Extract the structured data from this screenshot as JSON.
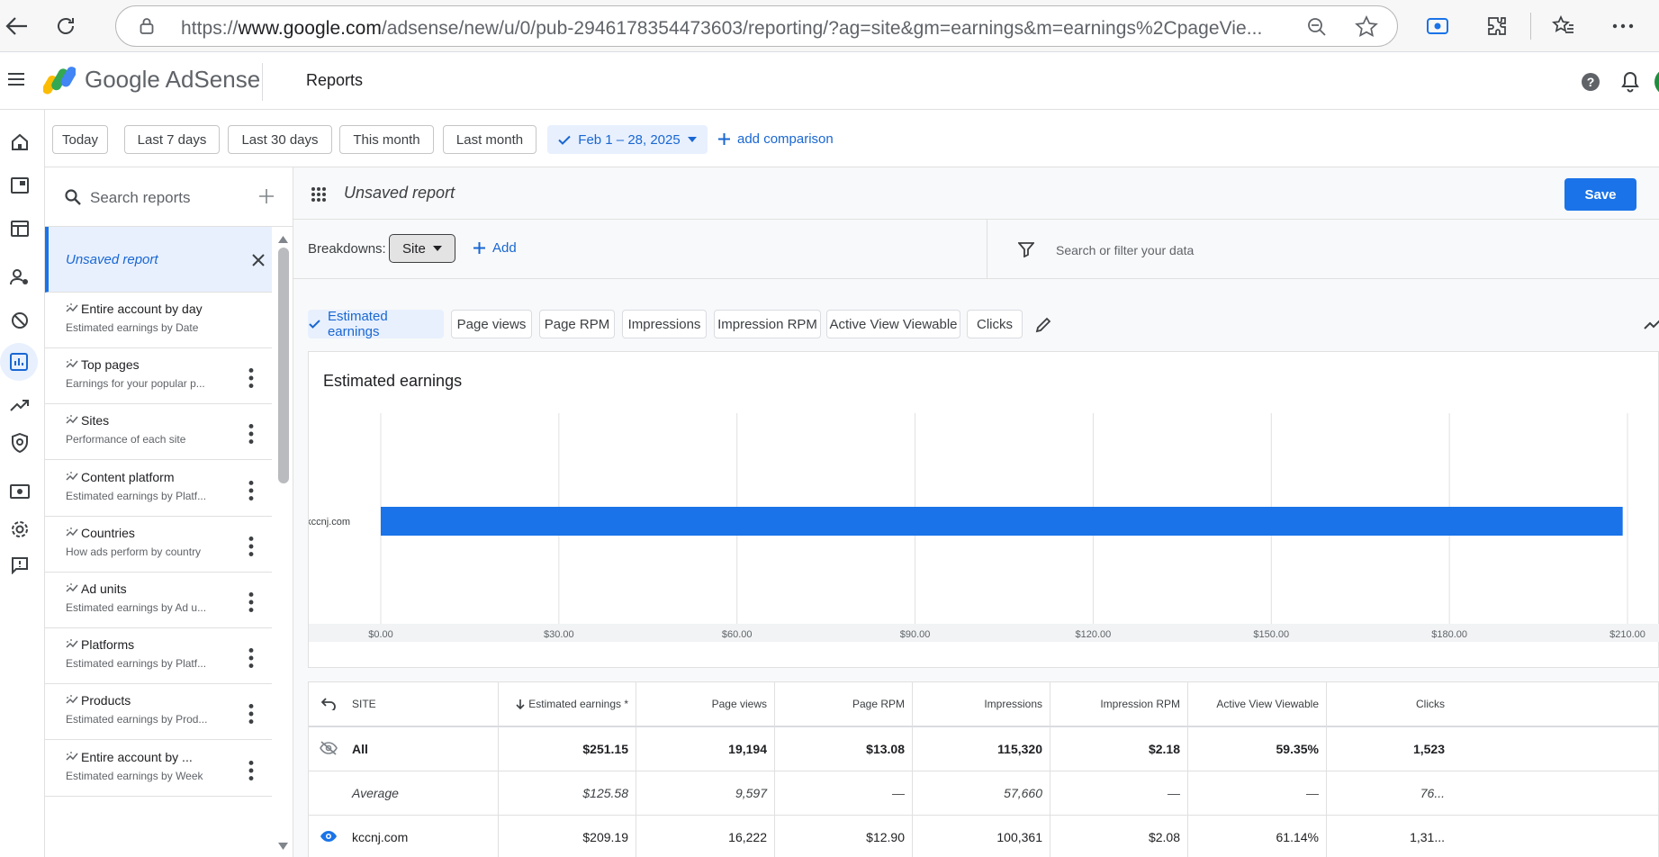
{
  "browser": {
    "url_scheme": "https://",
    "url_host": "www.google.com",
    "url_path": "/adsense/new/u/0/pub-2946178354473603/reporting/?ag=site&gm=earnings&m=earnings%2CpageVie..."
  },
  "header": {
    "brand": "Google AdSense",
    "title": "Reports"
  },
  "date_chips": [
    "Today",
    "Last 7 days",
    "Last 30 days",
    "This month",
    "Last month"
  ],
  "date_range": "Feb 1 – 28, 2025",
  "add_comparison": "add comparison",
  "report_list": {
    "search_placeholder": "Search reports",
    "active_item": "Unsaved report",
    "items": [
      {
        "title": "Entire account by day",
        "subtitle": "Estimated earnings by Date"
      },
      {
        "title": "Top pages",
        "subtitle": "Earnings for your popular p..."
      },
      {
        "title": "Sites",
        "subtitle": "Performance of each site"
      },
      {
        "title": "Content platform",
        "subtitle": "Estimated earnings by Platf..."
      },
      {
        "title": "Countries",
        "subtitle": "How ads perform by country"
      },
      {
        "title": "Ad units",
        "subtitle": "Estimated earnings by Ad u..."
      },
      {
        "title": "Platforms",
        "subtitle": "Estimated earnings by Platf..."
      },
      {
        "title": "Products",
        "subtitle": "Estimated earnings by Prod..."
      },
      {
        "title": "Entire account by ...",
        "subtitle": "Estimated earnings by Week"
      }
    ]
  },
  "report": {
    "name": "Unsaved report",
    "save_label": "Save",
    "breakdowns_label": "Breakdowns:",
    "breakdown_value": "Site",
    "add_label": "Add",
    "filter_placeholder": "Search or filter your data",
    "metrics": [
      "Estimated earnings",
      "Page views",
      "Page RPM",
      "Impressions",
      "Impression RPM",
      "Active View Viewable",
      "Clicks"
    ],
    "active_metric": "Estimated earnings"
  },
  "colors": {
    "accent": "#1a73e8",
    "bar": "#1a73e8"
  },
  "chart_data": {
    "type": "bar",
    "orientation": "horizontal",
    "title": "Estimated earnings",
    "categories": [
      "kccnj.com"
    ],
    "values": [
      209.19
    ],
    "xlim": [
      0,
      210
    ],
    "xticks": [
      "$0.00",
      "$30.00",
      "$60.00",
      "$90.00",
      "$120.00",
      "$150.00",
      "$180.00",
      "$210.00"
    ],
    "grid": true
  },
  "table": {
    "columns": [
      "SITE",
      "Estimated earnings *",
      "Page views",
      "Page RPM",
      "Impressions",
      "Impression RPM",
      "Active View Viewable",
      "Clicks"
    ],
    "rows": [
      {
        "name": "All",
        "cells": [
          "$251.15",
          "19,194",
          "$13.08",
          "115,320",
          "$2.18",
          "59.35%",
          "1,523"
        ]
      },
      {
        "name": "Average",
        "cells": [
          "$125.58",
          "9,597",
          "—",
          "57,660",
          "—",
          "—",
          "76..."
        ]
      },
      {
        "name": "kccnj.com",
        "cells": [
          "$209.19",
          "16,222",
          "$12.90",
          "100,361",
          "$2.08",
          "61.14%",
          "1,31..."
        ]
      }
    ]
  }
}
